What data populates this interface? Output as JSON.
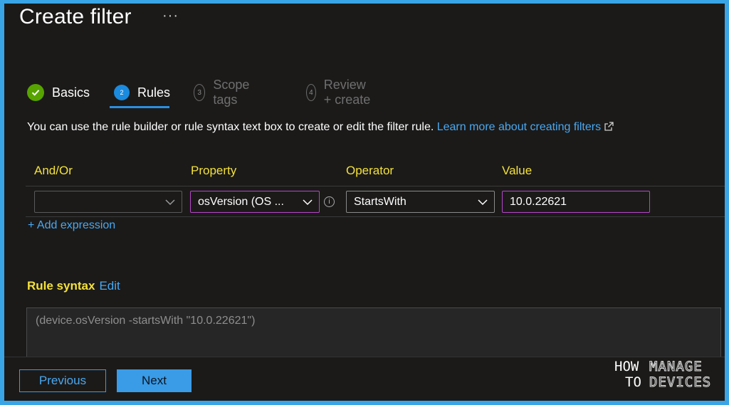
{
  "page": {
    "title": "Create filter",
    "more_label": "···"
  },
  "steps": [
    {
      "number": "",
      "label": "Basics",
      "state": "done"
    },
    {
      "number": "2",
      "label": "Rules",
      "state": "current"
    },
    {
      "number": "3",
      "label": "Scope tags",
      "state": "pending"
    },
    {
      "number": "4",
      "label": "Review + create",
      "state": "pending"
    }
  ],
  "description": {
    "text": "You can use the rule builder or rule syntax text box to create or edit the filter rule.",
    "link": "Learn more about creating filters"
  },
  "rule_table": {
    "headers": {
      "and_or": "And/Or",
      "property": "Property",
      "operator": "Operator",
      "value": "Value"
    },
    "row": {
      "and_or": "",
      "property": "osVersion (OS ...",
      "operator": "StartsWith",
      "value": "10.0.22621"
    },
    "add_expression": "+ Add expression"
  },
  "rule_syntax": {
    "label": "Rule syntax",
    "edit": "Edit",
    "text": "(device.osVersion -startsWith \"10.0.22621\")"
  },
  "footer": {
    "previous": "Previous",
    "next": "Next"
  },
  "logo": {
    "how": "HOW",
    "to": "TO",
    "manage": "MANAGE",
    "devices": "DEVICES"
  },
  "colors": {
    "accent": "#3a9be6",
    "highlight": "#f4e13a",
    "selected_border": "#b646c8",
    "success": "#57a300"
  },
  "icons": {
    "info": "info-icon",
    "external": "external-link-icon",
    "chevron": "chevron-down-icon",
    "check": "check-icon"
  }
}
